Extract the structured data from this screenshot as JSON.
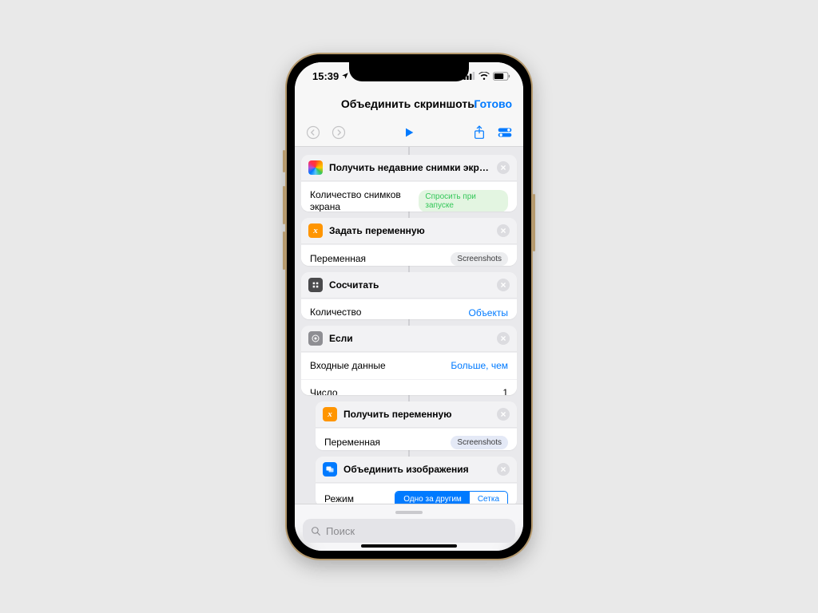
{
  "status": {
    "time": "15:39",
    "location_arrow": "➤"
  },
  "nav": {
    "title": "Объединить скриншоты",
    "done": "Готово"
  },
  "actions": [
    {
      "icon": "photos",
      "title": "Получить недавние снимки экрана",
      "rows": [
        {
          "label": "Количество снимков экрана",
          "pill": "Спросить при запуске",
          "pill_variant": "green"
        }
      ]
    },
    {
      "icon": "var",
      "title": "Задать переменную",
      "rows": [
        {
          "label": "Переменная",
          "pill": "Screenshots",
          "pill_variant": "plain"
        }
      ]
    },
    {
      "icon": "calc",
      "title": "Сосчитать",
      "rows": [
        {
          "label": "Количество",
          "value": "Объекты",
          "link": true
        }
      ]
    },
    {
      "icon": "gear",
      "title": "Если",
      "rows": [
        {
          "label": "Входные данные",
          "value": "Больше, чем",
          "link": true
        },
        {
          "label": "Число",
          "value": "1"
        }
      ]
    },
    {
      "icon": "var",
      "title": "Получить переменную",
      "indent": true,
      "rows": [
        {
          "label": "Переменная",
          "pill": "Screenshots",
          "pill_variant": "blue"
        }
      ]
    },
    {
      "icon": "combine",
      "title": "Объединить изображения",
      "indent": true,
      "rows": [
        {
          "label": "Режим",
          "segmented": [
            "Одно за другим",
            "Сетка"
          ],
          "active": 0
        }
      ]
    }
  ],
  "search": {
    "placeholder": "Поиск"
  }
}
